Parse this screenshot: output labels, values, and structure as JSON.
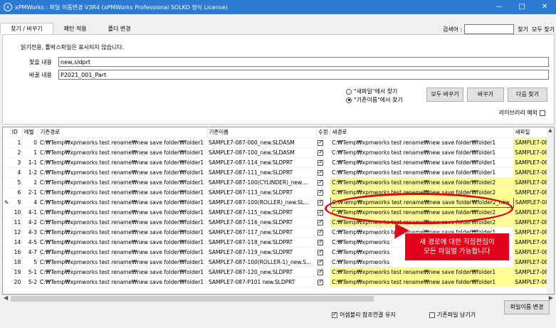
{
  "window": {
    "title": "xPMWorks : 파일 이름변경 V3R4 (xPMWorks Professional SOLKO 정식 License)",
    "minimize": "—",
    "maximize": "□",
    "close": "✕"
  },
  "tabs": [
    "찾기 / 바꾸기",
    "패턴 적용",
    "폴더 변경"
  ],
  "search": {
    "label": "검색어 :",
    "value": "",
    "find": "찾기",
    "find_all": "모두 찾기"
  },
  "form": {
    "notice": "읽기전용, 툴박스파일은 표시되지 않습니다.",
    "find_label": "찾을 내용",
    "find_value": "new,sldprt",
    "replace_label": "바꿀 내용",
    "replace_value": "P2021_001_Part",
    "radio_new": "\"새파일\"에서 찾기",
    "radio_old": "\"기존이름\"에서 찾기",
    "replace_all": "모두 바꾸기",
    "replace": "바꾸기",
    "find_next": "다음 찾기",
    "library_exclude": "라이브러리 예외"
  },
  "grid": {
    "columns": [
      "ID",
      "레벨",
      "기존경로",
      "기존이름",
      "수정",
      "새경로",
      "새파일"
    ],
    "rows": [
      {
        "id": "1",
        "level": "0",
        "oldpath": "C:₩Temp₩xpmworks test rename₩new save folder₩folder1",
        "oldname": "SAMPLE7-087-000_new.SLDASM",
        "newpath": "C:₩Temp₩xpmworks test rename₩new save folder₩folder1",
        "newfile": "SAMPLE7-087",
        "hl": false
      },
      {
        "id": "2",
        "level": "1",
        "oldpath": "C:₩Temp₩xpmworks test rename₩new save folder₩folder1",
        "oldname": "SAMPLE7-087-100_new.SLDASM",
        "newpath": "C:₩Temp₩xpmworks test rename₩new save folder₩folder1",
        "newfile": "SAMPLE7-087",
        "hl": false
      },
      {
        "id": "3",
        "level": "1-1",
        "oldpath": "C:₩Temp₩xpmworks test rename₩new save folder₩folder1",
        "oldname": "SAMPLE7-087-114_new.SLDPRT",
        "newpath": "C:₩Temp₩xpmworks test rename₩new save folder₩folder1",
        "newfile": "SAMPLE7-087",
        "hl": false
      },
      {
        "id": "4",
        "level": "1-2",
        "oldpath": "C:₩Temp₩xpmworks test rename₩new save folder₩folder1",
        "oldname": "SAMPLE7-087-111_new.SLDPRT",
        "newpath": "C:₩Temp₩xpmworks test rename₩new save folder₩folder1",
        "newfile": "SAMPLE7-087",
        "hl": false
      },
      {
        "id": "5",
        "level": "2",
        "oldpath": "C:₩Temp₩xpmworks test rename₩new save folder₩folder1",
        "oldname": "SAMPLE7-087-100(CYLINDER)_new....",
        "newpath": "C:₩Temp₩xpmworks test rename₩new save folder₩folder2",
        "newfile": "SAMPLE7-087",
        "hl": true
      },
      {
        "id": "6",
        "level": "2-1",
        "oldpath": "C:₩Temp₩xpmworks test rename₩new save folder₩folder1",
        "oldname": "SAMPLE7-087-113_new.SLDPRT",
        "newpath": "C:₩Temp₩xpmworks test rename₩new save folder₩folder2",
        "newfile": "SAMPLE7-087",
        "hl": true
      },
      {
        "id": "9",
        "level": "4",
        "oldpath": "C:₩Temp₩xpmworks test rename₩new save folder₩folder1",
        "oldname": "SAMPLE7-087-100(ROLLER)_new.SL...",
        "newpath": "C:₩Temp₩xpmworks test rename₩new save folder₩folder2_new",
        "newfile": "SAMPLE7-087",
        "hl": true,
        "editing": true
      },
      {
        "id": "10",
        "level": "4-1",
        "oldpath": "C:₩Temp₩xpmworks test rename₩new save folder₩folder1",
        "oldname": "SAMPLE7-087-115_new.SLDPRT",
        "newpath": "C:₩Temp₩xpmworks test rename₩new save folder₩folder2",
        "newfile": "SAMPLE7-087",
        "hl": true
      },
      {
        "id": "11",
        "level": "4-2",
        "oldpath": "C:₩Temp₩xpmworks test rename₩new save folder₩folder1",
        "oldname": "SAMPLE7-087-116_new.SLDPRT",
        "newpath": "C:₩Temp₩xpmworks test rename₩new save folder₩folder2",
        "newfile": "SAMPLE7-087",
        "hl": true
      },
      {
        "id": "12",
        "level": "4-3",
        "oldpath": "C:₩Temp₩xpmworks test rename₩new save folder₩folder1",
        "oldname": "SAMPLE7-087-117_new.SLDPRT",
        "newpath": "C:₩Temp₩xpmworks test rename₩new save folder₩folder1",
        "newfile": "SAMPLE7-087",
        "hl": false
      },
      {
        "id": "14",
        "level": "4-5",
        "oldpath": "C:₩Temp₩xpmworks test rename₩new save folder₩folder1",
        "oldname": "SAMPLE7-087-118_new.SLDPRT",
        "newpath": "C:₩Temp₩xpmworks",
        "newfile": "SAMPLE7-087",
        "hl": false
      },
      {
        "id": "16",
        "level": "4-7",
        "oldpath": "C:₩Temp₩xpmworks test rename₩new save folder₩folder1",
        "oldname": "SAMPLE7-087-119_new.SLDPRT",
        "newpath": "C:₩Temp₩xpmworks",
        "newfile": "SAMPLE7-087",
        "hl": false
      },
      {
        "id": "18",
        "level": "5",
        "oldpath": "C:₩Temp₩xpmworks test rename₩new save folder₩folder1",
        "oldname": "SAMPLE7-087-100(ROLLER-1)_new.S...",
        "newpath": "C:₩Temp₩xpmworks",
        "newfile": "SAMPLE7-087",
        "hl": false
      },
      {
        "id": "19",
        "level": "5-1",
        "oldpath": "C:₩Temp₩xpmworks test rename₩new save folder₩folder1",
        "oldname": "SAMPLE7-087-120_new.SLDPRT",
        "newpath": "C:₩Temp₩xpmworks test rename₩new save folder₩folder1",
        "newfile": "SAMPLE7-087",
        "hl": true
      },
      {
        "id": "20",
        "level": "5-2",
        "oldpath": "C:₩Temp₩xpmworks test rename₩new save folder₩folder1",
        "oldname": "SAMPLE7-087-P101 new.SLDPRT",
        "newpath": "C:₩Temp₩xpmworks test rename₩new save folder₩folder1",
        "newfile": "SAMPLE7-08",
        "hl": true
      }
    ]
  },
  "callout": {
    "line1": "새 경로에 대한 직접편집이",
    "line2": "모든 파일별 가능합니다"
  },
  "bottom": {
    "keep_refs": "어셈블리 참조연결 유지",
    "keep_old": "기존파일 남기기",
    "rename": "파일이름 변경"
  },
  "colors": {
    "titlebar": "#2b7bd3",
    "highlight": "#ffff99",
    "annotation": "#e3001b"
  }
}
